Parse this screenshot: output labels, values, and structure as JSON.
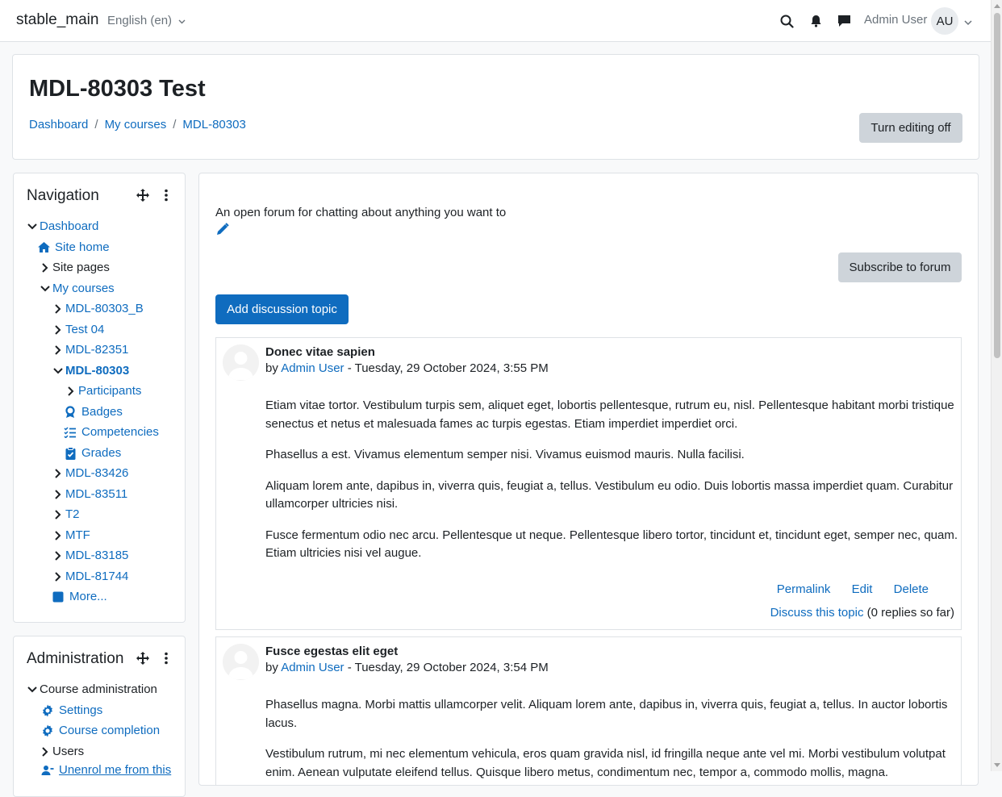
{
  "navbar": {
    "site_name": "stable_main",
    "language": "English (en)",
    "user_name": "Admin User",
    "user_initials": "AU"
  },
  "header": {
    "title": "MDL-80303 Test",
    "breadcrumb": [
      "Dashboard",
      "My courses",
      "MDL-80303"
    ],
    "edit_toggle": "Turn editing off"
  },
  "navigation_block": {
    "title": "Navigation",
    "items": [
      {
        "label": "Dashboard"
      },
      {
        "label": "Site home"
      },
      {
        "label": "Site pages"
      },
      {
        "label": "My courses"
      },
      {
        "label": "MDL-80303_B"
      },
      {
        "label": "Test 04"
      },
      {
        "label": "MDL-82351"
      },
      {
        "label": "MDL-80303"
      },
      {
        "label": "Participants"
      },
      {
        "label": "Badges"
      },
      {
        "label": "Competencies"
      },
      {
        "label": "Grades"
      },
      {
        "label": "MDL-83426"
      },
      {
        "label": "MDL-83511"
      },
      {
        "label": "T2"
      },
      {
        "label": "MTF"
      },
      {
        "label": "MDL-83185"
      },
      {
        "label": "MDL-81744"
      },
      {
        "label": "More..."
      }
    ]
  },
  "admin_block": {
    "title": "Administration",
    "items": [
      {
        "label": "Course administration"
      },
      {
        "label": "Settings"
      },
      {
        "label": "Course completion"
      },
      {
        "label": "Users"
      },
      {
        "label": "Unenrol me from this"
      }
    ]
  },
  "forum": {
    "intro": "An open forum for chatting about anything you want to",
    "subscribe_label": "Subscribe to forum",
    "add_topic_label": "Add discussion topic",
    "posts": [
      {
        "subject": "Donec vitae sapien",
        "by": "by",
        "author": "Admin User",
        "date": "- Tuesday, 29 October 2024, 3:55 PM",
        "paragraphs": [
          "Etiam vitae tortor. Vestibulum turpis sem, aliquet eget, lobortis pellentesque, rutrum eu, nisl. Pellentesque habitant morbi tristique senectus et netus et malesuada fames ac turpis egestas. Etiam imperdiet imperdiet orci.",
          "Phasellus a est. Vivamus elementum semper nisi. Vivamus euismod mauris. Nulla facilisi.",
          "Aliquam lorem ante, dapibus in, viverra quis, feugiat a, tellus. Vestibulum eu odio. Duis lobortis massa imperdiet quam. Curabitur ullamcorper ultricies nisi.",
          "Fusce fermentum odio nec arcu. Pellentesque ut neque. Pellentesque libero tortor, tincidunt et, tincidunt eget, semper nec, quam. Etiam ultricies nisi vel augue."
        ],
        "actions": [
          "Permalink",
          "Edit",
          "Delete"
        ],
        "discuss_label": "Discuss this topic",
        "replies": "(0 replies so far)"
      },
      {
        "subject": "Fusce egestas elit eget",
        "by": "by",
        "author": "Admin User",
        "date": "- Tuesday, 29 October 2024, 3:54 PM",
        "paragraphs": [
          "Phasellus magna. Morbi mattis ullamcorper velit. Aliquam lorem ante, dapibus in, viverra quis, feugiat a, tellus. In auctor lobortis lacus.",
          "Vestibulum rutrum, mi nec elementum vehicula, eros quam gravida nisl, id fringilla neque ante vel mi. Morbi vestibulum volutpat enim. Aenean vulputate eleifend tellus. Quisque libero metus, condimentum nec, tempor a, commodo mollis, magna."
        ]
      }
    ]
  },
  "colors": {
    "link": "#0f6cbf",
    "primary_button": "#0f6cbf",
    "secondary_button": "#ced4da",
    "border": "#dee2e6",
    "page_bg": "#f8f9fa"
  }
}
